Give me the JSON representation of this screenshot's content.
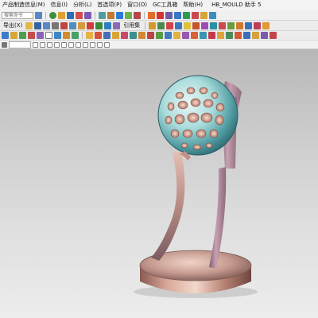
{
  "menu": {
    "items": [
      {
        "label": "产品制造信息(M)"
      },
      {
        "label": "信息(I)"
      },
      {
        "label": "分析(L)"
      },
      {
        "label": "首选项(P)"
      },
      {
        "label": "窗口(O)"
      },
      {
        "label": "GC工具箱"
      },
      {
        "label": "帮助(H)"
      }
    ],
    "window_title": "HB_MOULD 助手 5"
  },
  "toolbar1": {
    "search_placeholder": "搜索命令"
  },
  "toolbar2": {
    "export_label": "导出(X)",
    "reference_set_label": "引用集"
  },
  "colors": {
    "viewport_top": "#b7b7b7",
    "viewport_bottom": "#ededed",
    "trophy_copper": "#c99a8a",
    "ball_teal": "#9fd6d8"
  }
}
